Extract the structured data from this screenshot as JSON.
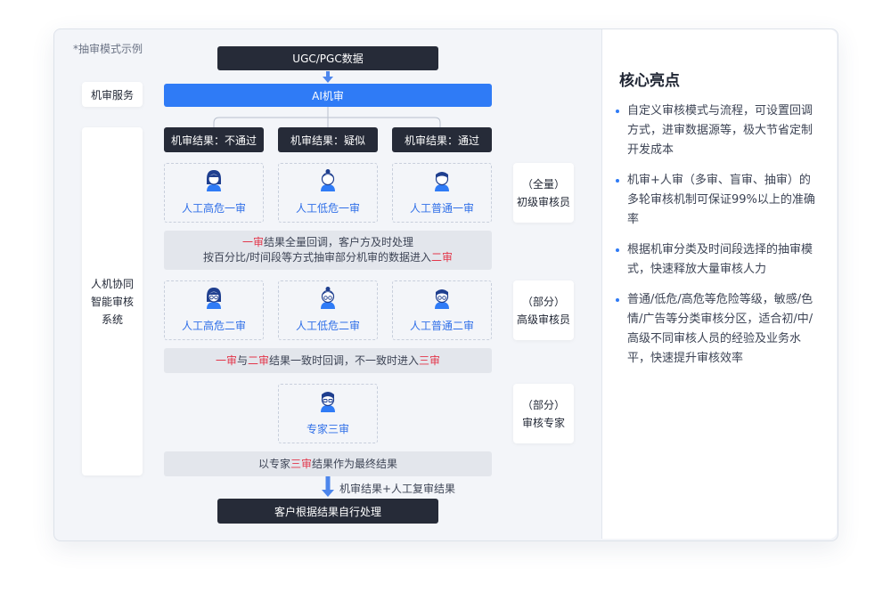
{
  "note": "*抽审模式示例",
  "flow": {
    "source": "UGC/PGC数据",
    "ai": "AI机审",
    "results": [
      "机审结果：不通过",
      "机审结果：疑似",
      "机审结果：通过"
    ],
    "stage1": [
      "人工高危一审",
      "人工低危一审",
      "人工普通一审"
    ],
    "band1": {
      "line1": {
        "r": "一审",
        "t": "结果全量回调，客户方及时处理"
      },
      "line2": {
        "t": "按百分比/时间段等方式抽审部分机审的数据进入",
        "r": "二审"
      }
    },
    "stage2": [
      "人工高危二审",
      "人工低危二审",
      "人工普通二审"
    ],
    "band2": {
      "r1": "一审",
      "t1": "与",
      "r2": "二审",
      "t2": "结果一致时回调，不一致时进入",
      "r3": "三审"
    },
    "stage3": "专家三审",
    "band3": {
      "t1": "以专家",
      "r": "三审",
      "t2": "结果作为最终结果"
    },
    "arrow_label": "机审结果+人工复审结果",
    "final": "客户根据结果自行处理"
  },
  "left_labels": {
    "machine": "机审服务",
    "system": [
      "人机协同",
      "智能审核",
      "系统"
    ]
  },
  "roles": [
    {
      "scope": "（全量）",
      "name": "初级审核员"
    },
    {
      "scope": "（部分）",
      "name": "高级审核员"
    },
    {
      "scope": "（部分）",
      "name": "审核专家"
    }
  ],
  "highlights": {
    "title": "核心亮点",
    "points": [
      "自定义审核模式与流程，可设置回调方式，进审数据源等，极大节省定制开发成本",
      "机审+人审（多审、盲审、抽审）的多轮审核机制可保证99%以上的准确率",
      "根据机审分类及时间段选择的抽审模式，快速释放大量审核人力",
      "普通/低危/高危等危险等级，敏感/色情/广告等分类审核分区，适合初/中/高级不同审核人员的经验及业务水平，快速提升审核效率"
    ]
  },
  "colors": {
    "accent": "#2f7bf6",
    "dark": "#262b38",
    "highlight_red": "#e3364a"
  }
}
